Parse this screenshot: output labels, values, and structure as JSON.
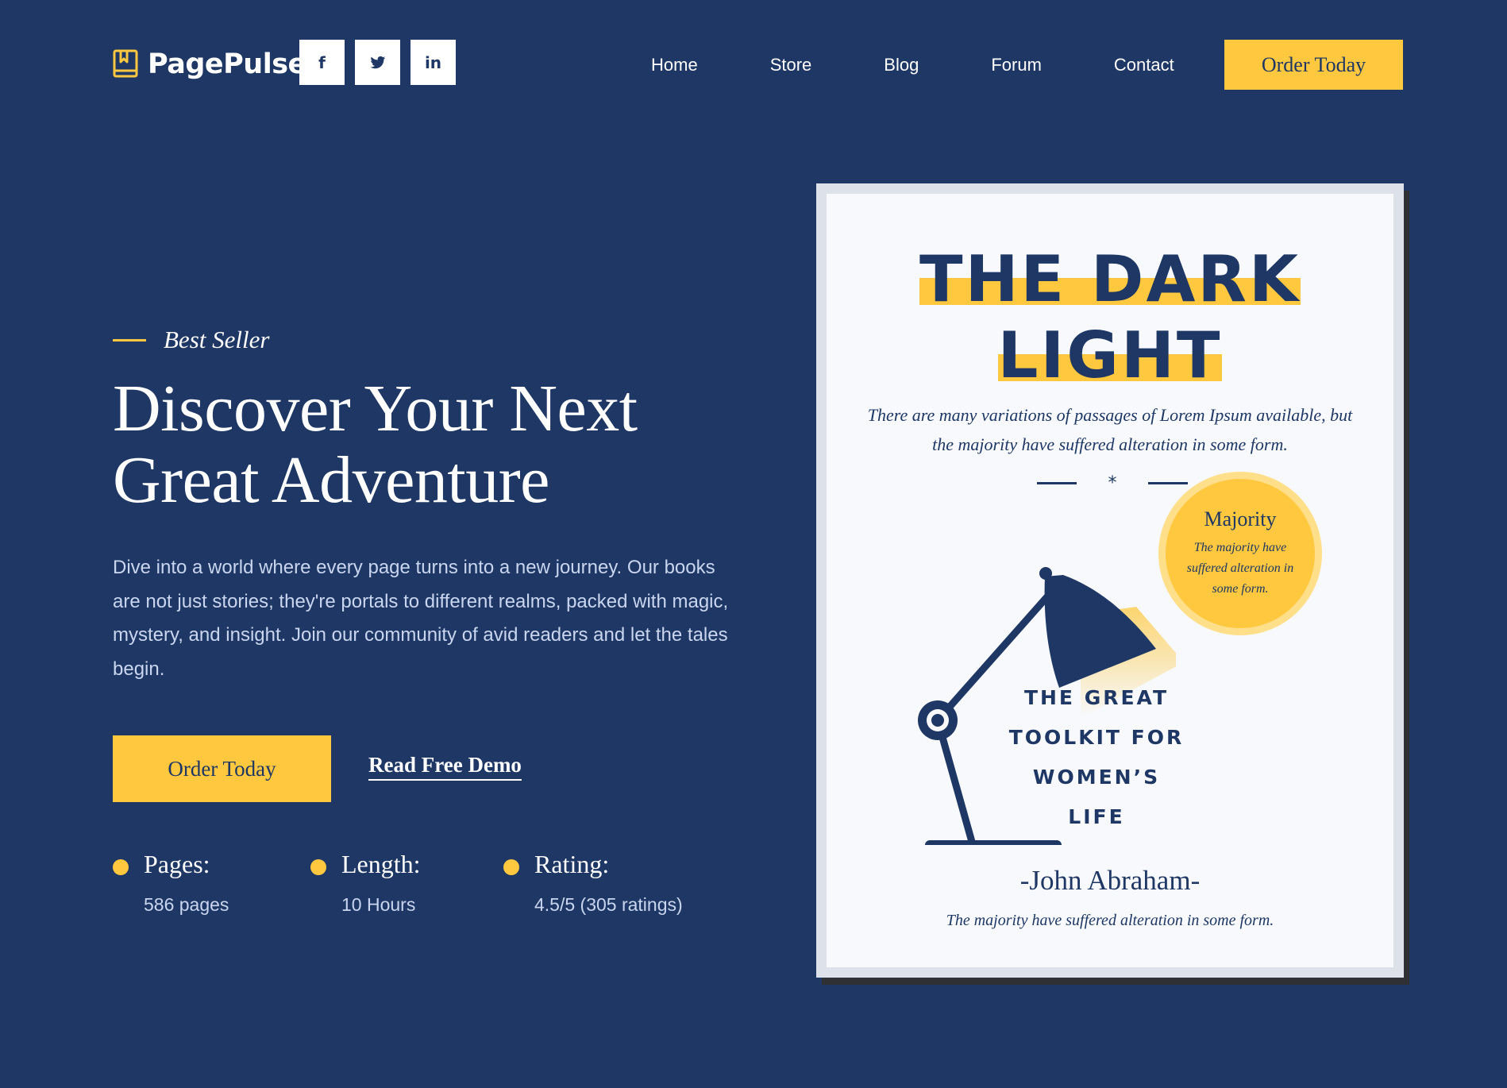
{
  "brand": {
    "name": "PagePulse",
    "icon": "book-icon"
  },
  "social": [
    {
      "label": "f",
      "icon": "facebook-icon"
    },
    {
      "label": "",
      "icon": "twitter-icon"
    },
    {
      "label": "in",
      "icon": "linkedin-icon"
    }
  ],
  "nav": {
    "items": [
      "Home",
      "Store",
      "Blog",
      "Forum",
      "Contact"
    ],
    "cta": "Order Today"
  },
  "hero": {
    "eyebrow": "Best Seller",
    "title_line1": "Discover Your Next",
    "title_line2": "Great Adventure",
    "description": "Dive into a world where every page turns into a new journey. Our books are not just stories; they're portals to different realms, packed with magic, mystery, and insight. Join our community of avid readers and let the tales begin.",
    "primary_button": "Order Today",
    "secondary_link": "Read Free Demo"
  },
  "stats": [
    {
      "label": "Pages:",
      "value": "586 pages"
    },
    {
      "label": "Length:",
      "value": "10 Hours"
    },
    {
      "label": "Rating:",
      "value": "4.5/5 (305 ratings)"
    }
  ],
  "book": {
    "title_line1": "THE DARK",
    "title_line2": "LIGHT",
    "subtitle": "There are many variations of passages of Lorem Ipsum available, but the majority have suffered alteration in some form.",
    "divider_symbol": "*",
    "badge_title": "Majority",
    "badge_text": "The majority have suffered alteration in some form.",
    "toolkit_lines": [
      "THE GREAT",
      "TOOLKIT FOR",
      "WOMEN’S",
      "LIFE"
    ],
    "author": "-John Abraham-",
    "author_note": "The majority have suffered alteration in some form."
  },
  "colors": {
    "background": "#1e3764",
    "accent": "#ffc83f",
    "muted_text": "#c9d6f0",
    "cover": "#f7f9fd"
  }
}
